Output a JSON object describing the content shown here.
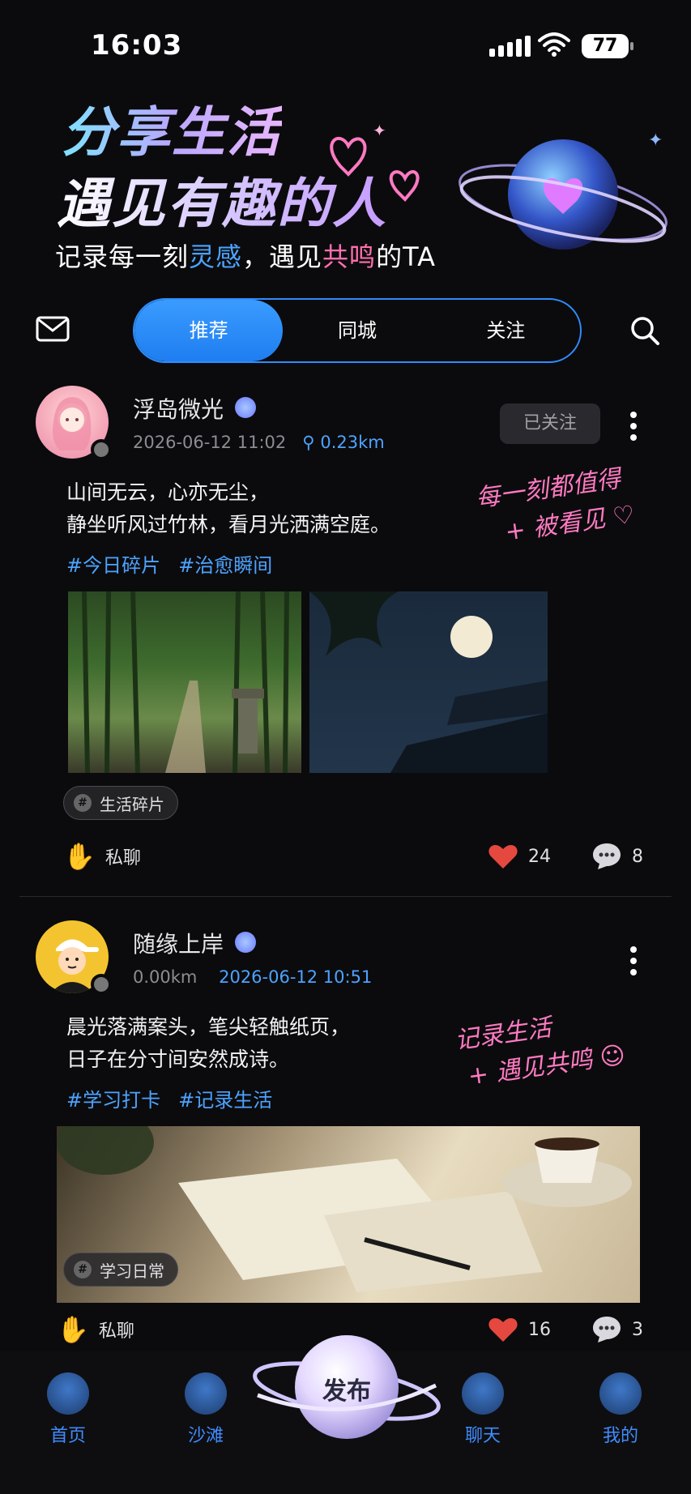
{
  "status_bar": {
    "time": "16:03",
    "battery": "77"
  },
  "hero": {
    "title_line1": "分享生活",
    "title_line2": "遇见有趣的人",
    "subtitle_part1": "记录每一刻",
    "subtitle_hl1": "灵感",
    "subtitle_part2": "，遇见",
    "subtitle_hl2": "共鸣",
    "subtitle_part3": "的TA"
  },
  "tabs": [
    {
      "label": "推荐",
      "active": true
    },
    {
      "label": "同城",
      "active": false
    },
    {
      "label": "关注",
      "active": false
    }
  ],
  "posts": [
    {
      "username": "浮岛微光",
      "meta_date": "2026-06-12 11:02",
      "meta_distance": "0.23km",
      "follow_label": "已关注",
      "text_line1": "山间无云，心亦无尘，",
      "text_line2": "静坐听风过竹林，看月光洒满空庭。",
      "tags": [
        "#今日碎片",
        "#治愈瞬间"
      ],
      "handwriting_line1": "每一刻都值得",
      "handwriting_line2": "+ 被看见 ♡",
      "chip": "生活碎片",
      "chat_label": "私聊",
      "likes": "24",
      "comments": "8"
    },
    {
      "username": "随缘上岸",
      "meta_distance": "0.00km",
      "meta_date": "2026-06-12 10:51",
      "text_line1": "晨光落满案头，笔尖轻触纸页，",
      "text_line2": "日子在分寸间安然成诗。",
      "tags": [
        "#学习打卡",
        "#记录生活"
      ],
      "handwriting_line1": "记录生活",
      "handwriting_line2": "+ 遇见共鸣 ☺",
      "chip": "学习日常",
      "chat_label": "私聊",
      "likes": "16",
      "comments": "3"
    }
  ],
  "bottom_nav": {
    "items": [
      {
        "label": "首页",
        "icon": "home-icon"
      },
      {
        "label": "沙滩",
        "icon": "beach-icon"
      },
      {
        "label": "聊天",
        "icon": "chat-icon"
      },
      {
        "label": "我的",
        "icon": "profile-icon"
      }
    ],
    "publish_label": "发布"
  },
  "colors": {
    "accent": "#2f8cff",
    "pink": "#ff6fae",
    "like_red": "#e5483f",
    "background": "#0b0b0d"
  }
}
